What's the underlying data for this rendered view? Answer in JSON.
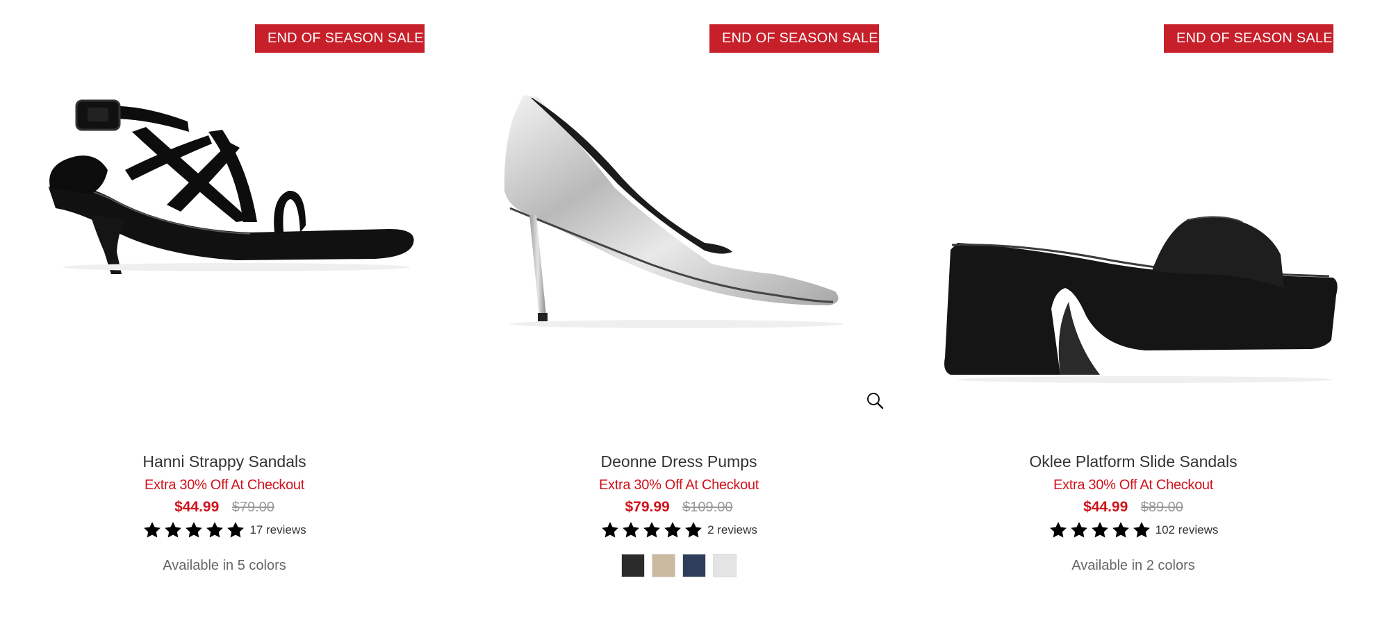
{
  "products": [
    {
      "badge": "END OF SEASON SALE",
      "image_icon": "strappy-sandal-image",
      "title": "Hanni Strappy Sandals",
      "promo": "Extra 30% Off At Checkout",
      "sale_price": "$44.99",
      "original_price": "$79.00",
      "rating": 5,
      "reviews": "17 reviews",
      "availability": "Available in 5 colors"
    },
    {
      "badge": "END OF SEASON SALE",
      "image_icon": "metallic-pump-image",
      "title": "Deonne Dress Pumps",
      "promo": "Extra 30% Off At Checkout",
      "sale_price": "$79.99",
      "original_price": "$109.00",
      "rating": 5,
      "reviews": "2 reviews",
      "swatches": [
        "#2b2b2b",
        "#cbb9a0",
        "#2f3d5c",
        "#e4e4e4"
      ],
      "zoom_icon": "zoom-icon"
    },
    {
      "badge": "END OF SEASON SALE",
      "image_icon": "platform-slide-image",
      "title": "Oklee Platform Slide Sandals",
      "promo": "Extra 30% Off At Checkout",
      "sale_price": "$44.99",
      "original_price": "$89.00",
      "rating": 5,
      "reviews": "102 reviews",
      "availability": "Available in 2 colors"
    }
  ],
  "colors": {
    "badge": "#c8202a",
    "promo": "#d0121b",
    "sale_price": "#d0121b",
    "original_price": "#999999",
    "star": "#000000"
  }
}
